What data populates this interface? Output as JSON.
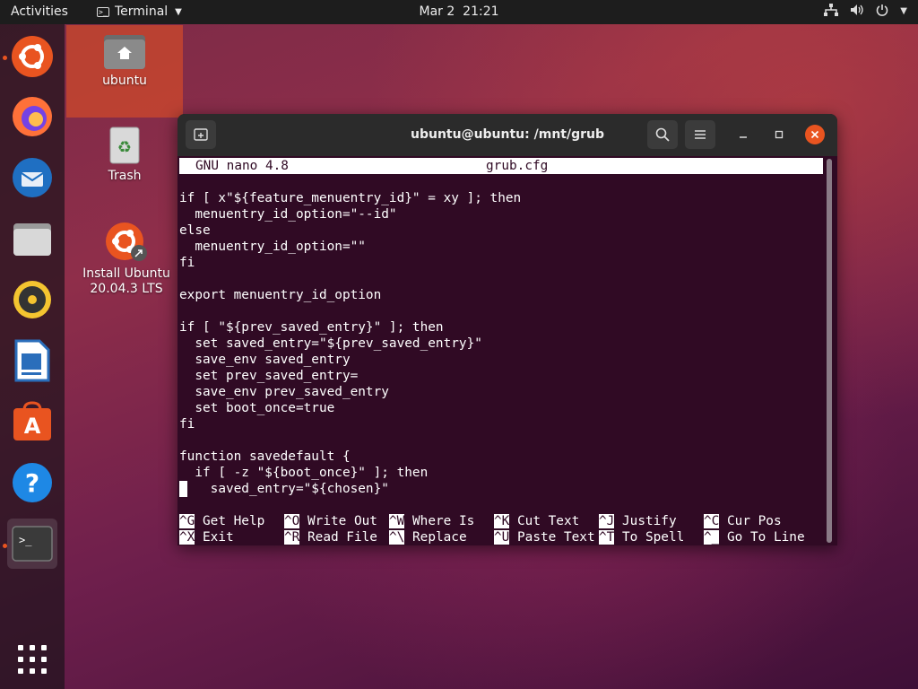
{
  "topbar": {
    "activities": "Activities",
    "app_name": "Terminal",
    "clock": "Mar 2  21:21",
    "tray_icons": [
      "network-icon",
      "volume-icon",
      "power-icon",
      "chevron-down-icon"
    ]
  },
  "dock": {
    "items": [
      "ubuntu-icon",
      "firefox-icon",
      "thunderbird-icon",
      "files-icon",
      "rhythmbox-icon",
      "writer-icon",
      "software-icon",
      "help-icon",
      "terminal-icon"
    ],
    "show_apps": "show-applications-icon"
  },
  "desktop": {
    "icons": [
      {
        "label": "ubuntu"
      },
      {
        "label": "Trash"
      },
      {
        "label_line1": "Install Ubuntu",
        "label_line2": "20.04.3 LTS"
      }
    ]
  },
  "window": {
    "title": "ubuntu@ubuntu: /mnt/grub",
    "accent": "#e95420",
    "background": "#300a24"
  },
  "nano": {
    "version": "GNU nano 4.8",
    "filename": "grub.cfg",
    "lines": [
      "if [ x\"${feature_menuentry_id}\" = xy ]; then",
      "  menuentry_id_option=\"--id\"",
      "else",
      "  menuentry_id_option=\"\"",
      "fi",
      "",
      "export menuentry_id_option",
      "",
      "if [ \"${prev_saved_entry}\" ]; then",
      "  set saved_entry=\"${prev_saved_entry}\"",
      "  save_env saved_entry",
      "  set prev_saved_entry=",
      "  save_env prev_saved_entry",
      "  set boot_once=true",
      "fi",
      "",
      "function savedefault {",
      "  if [ -z \"${boot_once}\" ]; then",
      "    saved_entry=\"${chosen}\""
    ],
    "shortcuts": [
      {
        "key": "^G",
        "label": " Get Help"
      },
      {
        "key": "^O",
        "label": " Write Out"
      },
      {
        "key": "^W",
        "label": " Where Is"
      },
      {
        "key": "^K",
        "label": " Cut Text"
      },
      {
        "key": "^J",
        "label": " Justify"
      },
      {
        "key": "^C",
        "label": " Cur Pos"
      },
      {
        "key": "^X",
        "label": " Exit"
      },
      {
        "key": "^R",
        "label": " Read File"
      },
      {
        "key": "^\\",
        "label": " Replace"
      },
      {
        "key": "^U",
        "label": " Paste Text"
      },
      {
        "key": "^T",
        "label": " To Spell"
      },
      {
        "key": "^_",
        "label": " Go To Line"
      }
    ]
  }
}
